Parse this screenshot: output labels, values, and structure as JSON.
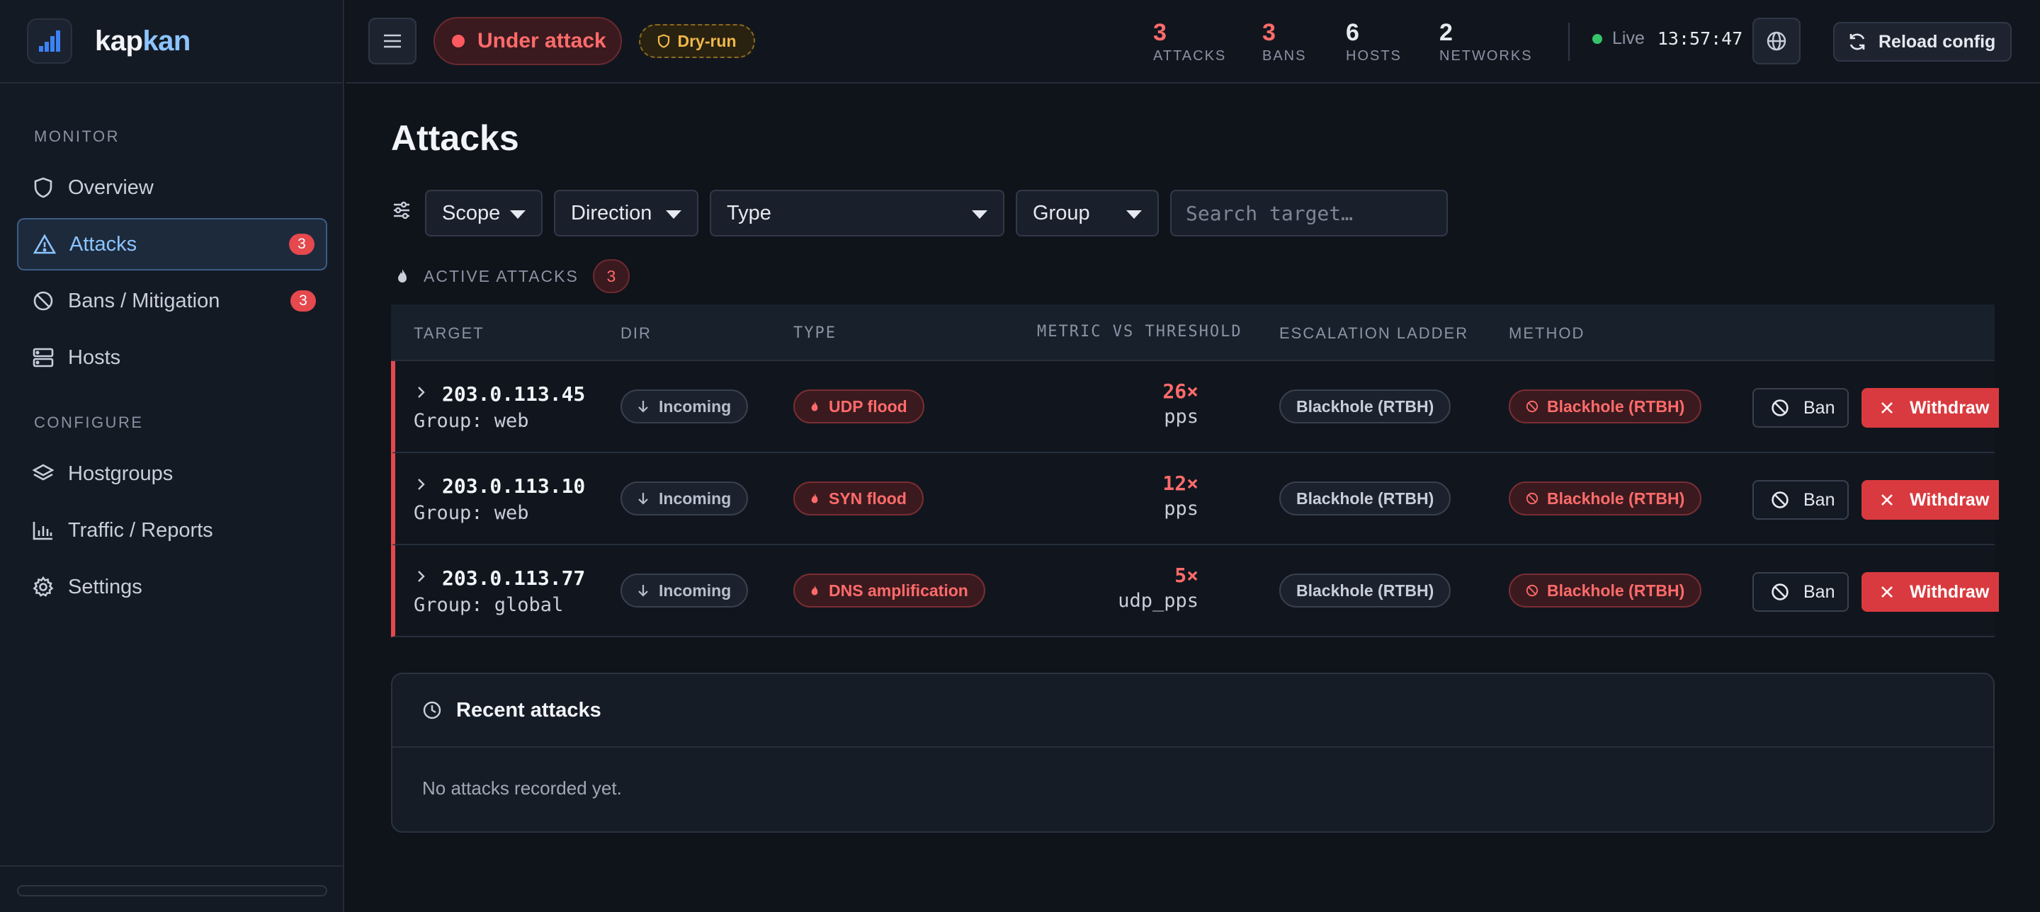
{
  "brand": {
    "name_a": "kap",
    "name_b": "kan"
  },
  "sidebar": {
    "monitor_label": "MONITOR",
    "configure_label": "CONFIGURE",
    "items": [
      {
        "label": "Overview",
        "icon": "shield-icon"
      },
      {
        "label": "Attacks",
        "icon": "alert-triangle-icon",
        "badge": "3",
        "active": true
      },
      {
        "label": "Bans / Mitigation",
        "icon": "ban-icon",
        "badge": "3"
      },
      {
        "label": "Hosts",
        "icon": "server-icon"
      },
      {
        "label": "Hostgroups",
        "icon": "layers-icon"
      },
      {
        "label": "Traffic / Reports",
        "icon": "bar-chart-icon"
      },
      {
        "label": "Settings",
        "icon": "gear-icon"
      }
    ]
  },
  "topbar": {
    "status": "Under attack",
    "mode": "Dry-run",
    "stats": [
      {
        "value": "3",
        "label": "ATTACKS"
      },
      {
        "value": "3",
        "label": "BANS"
      },
      {
        "value": "6",
        "label": "HOSTS"
      },
      {
        "value": "2",
        "label": "NETWORKS"
      }
    ],
    "live_label": "Live",
    "time": "13:57:47",
    "reload_label": "Reload config"
  },
  "main": {
    "title": "Attacks",
    "filters": {
      "scope": "Scope",
      "direction": "Direction",
      "type": "Type",
      "group": "Group",
      "search_placeholder": "Search target…"
    },
    "active_label": "ACTIVE ATTACKS",
    "active_count": "3",
    "table": {
      "headers": [
        "TARGET",
        "DIR",
        "TYPE",
        "METRIC VS THRESHOLD",
        "ESCALATION LADDER",
        "METHOD"
      ],
      "rows": [
        {
          "ip": "203.0.113.45",
          "group": "Group: web",
          "dir": "Incoming",
          "type": "UDP flood",
          "mult": "26×",
          "unit": "pps",
          "escalation": "Blackhole (RTBH)",
          "method": "Blackhole (RTBH)",
          "ban": "Ban",
          "withdraw": "Withdraw"
        },
        {
          "ip": "203.0.113.10",
          "group": "Group: web",
          "dir": "Incoming",
          "type": "SYN flood",
          "mult": "12×",
          "unit": "pps",
          "escalation": "Blackhole (RTBH)",
          "method": "Blackhole (RTBH)",
          "ban": "Ban",
          "withdraw": "Withdraw"
        },
        {
          "ip": "203.0.113.77",
          "group": "Group: global",
          "dir": "Incoming",
          "type": "DNS amplification",
          "mult": "5×",
          "unit": "udp_pps",
          "escalation": "Blackhole (RTBH)",
          "method": "Blackhole (RTBH)",
          "ban": "Ban",
          "withdraw": "Withdraw"
        }
      ]
    },
    "recent": {
      "title": "Recent attacks",
      "empty": "No attacks recorded yet."
    }
  }
}
